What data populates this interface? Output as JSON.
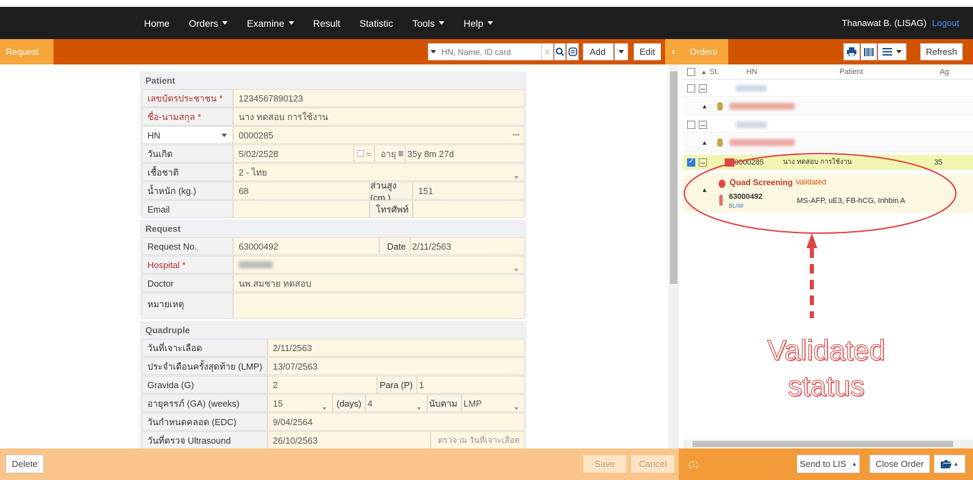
{
  "nav": {
    "items": [
      "Home",
      "Orders",
      "Examine",
      "Result",
      "Statistic",
      "Tools",
      "Help"
    ],
    "user": "Thanawat B. (LISAG)",
    "logout": "Logout"
  },
  "request_bar": {
    "tab": "Request",
    "search_placeholder": "HN, Name, ID card",
    "add": "Add",
    "edit": "Edit"
  },
  "orders_bar": {
    "tab": "Orders",
    "refresh": "Refresh"
  },
  "patient": {
    "title": "Patient",
    "id_label": "เลขบัตรประชาชน *",
    "id_value": "1234567890123",
    "name_label": "ชื่อ-นามสกุล *",
    "name_value": "นาง ทดสอบ การใช้งาน",
    "hn_label": "HN",
    "hn_value": "0000285",
    "hn_more": "•••",
    "dob_label": "วันเกิด",
    "dob_value": "5/02/2528",
    "approx": "≈",
    "age_label": "อายุ",
    "age_value": "35y 8m 27d",
    "nation_label": "เชื้อชาติ",
    "nation_value": "2 - ไทย",
    "weight_label": "น้ำหนัก (kg.)",
    "weight_value": "68",
    "height_label": "ส่วนสูง (cm.)",
    "height_value": "151",
    "email_label": "Email",
    "email_value": "",
    "phone_label": "โทรศัพท์",
    "phone_value": ""
  },
  "request": {
    "title": "Request",
    "no_label": "Request No.",
    "no_value": "63000492",
    "date_label": "Date",
    "date_value": "2/11/2563",
    "hospital_label": "Hospital *",
    "doctor_label": "Doctor",
    "doctor_value": "นพ.สมชาย ทดสอบ",
    "note_label": "หมายเหตุ"
  },
  "quad": {
    "title": "Quadruple",
    "blood_label": "วันที่เจาะเลือด",
    "blood_value": "2/11/2563",
    "lmp_label": "ประจำเดือนครั้งสุดท้าย (LMP)",
    "lmp_value": "13/07/2563",
    "gravida_label": "Gravida (G)",
    "gravida_value": "2",
    "para_label": "Para (P)",
    "para_value": "1",
    "ga_label": "อายุครรภ์ (GA) (weeks)",
    "ga_weeks": "15",
    "days_label": "(days)",
    "days_value": "4",
    "by_label": "นับตาม",
    "by_value": "LMP",
    "edc_label": "วันกำหนดคลอด (EDC)",
    "edc_value": "9/04/2564",
    "us_label": "วันที่ตรวจ Ultrasound",
    "us_value": "26/10/2563",
    "us_hint": "ตรวจ ณ วันที่เจาะเลือด"
  },
  "orders": {
    "col_st": "St.",
    "col_hn": "HN",
    "col_patient": "Patient",
    "col_age": "Ag",
    "selected_hn": "0000285",
    "selected_patient": "นาง ทดสอบ การใช้งาน",
    "selected_age": "35",
    "test_name": "Quad Screening",
    "test_status": "Validated",
    "req_no": "63000492",
    "specimen": "BL/IM",
    "tests": "MS-AFP, uE3, FB-hCG, Inhbin A",
    "status_color": "#e04545",
    "annotation": [
      "Validated",
      "status"
    ]
  },
  "footer": {
    "delete": "Delete",
    "save": "Save",
    "cancel": "Cancel",
    "count": "(1)",
    "send": "Send to LIS",
    "close": "Close Order"
  }
}
